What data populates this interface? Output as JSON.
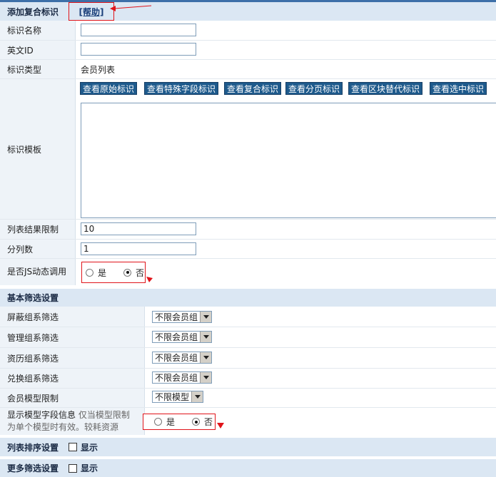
{
  "header": {
    "title": "添加复合标识",
    "help_link": "[帮助]"
  },
  "fields": {
    "name_label": "标识名称",
    "en_id_label": "英文ID",
    "type_label": "标识类型",
    "type_value": "会员列表",
    "template_label": "标识模板",
    "limit_label": "列表结果限制",
    "limit_value": "10",
    "columns_label": "分列数",
    "columns_value": "1",
    "js_label": "是否JS动态调用",
    "js_yes": "是",
    "js_no": "否"
  },
  "tag_buttons": [
    "查看原始标识",
    "查看特殊字段标识",
    "查看复合标识",
    "查看分页标识",
    "查看区块替代标识",
    "查看选中标识"
  ],
  "filter_section": {
    "title": "基本筛选设置",
    "rows": [
      {
        "label": "屏蔽组系筛选",
        "value": "不限会员组"
      },
      {
        "label": "管理组系筛选",
        "value": "不限会员组"
      },
      {
        "label": "资历组系筛选",
        "value": "不限会员组"
      },
      {
        "label": "兑换组系筛选",
        "value": "不限会员组"
      },
      {
        "label": "会员模型限制",
        "value": "不限模型"
      }
    ],
    "show_fields_label": "显示模型字段信息",
    "show_fields_hint_1": "仅当模型限制",
    "show_fields_hint_2": "为单个模型时有效。较耗资源",
    "yes": "是",
    "no": "否"
  },
  "order_section": {
    "title": "列表排序设置",
    "show_label": "显示"
  },
  "more_section": {
    "title": "更多筛选设置",
    "show_label": "显示"
  }
}
